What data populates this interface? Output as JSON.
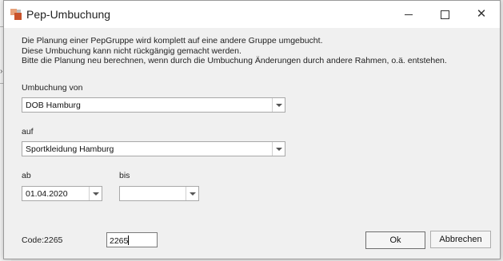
{
  "window": {
    "title": "Pep-Umbuchung",
    "close_glyph": "✕"
  },
  "info": {
    "line1": "Die Planung einer PepGruppe wird komplett auf eine andere Gruppe umgebucht.",
    "line2": "Diese Umbuchung kann nicht rückgängig gemacht werden.",
    "line3": "Bitte die Planung neu berechnen, wenn durch die Umbuchung Änderungen durch andere Rahmen, o.ä. entstehen."
  },
  "umbuchung_von": {
    "label": "Umbuchung von",
    "value": "DOB Hamburg"
  },
  "auf": {
    "label": "auf",
    "value": "Sportkleidung Hamburg"
  },
  "ab": {
    "label": "ab",
    "value": "01.04.2020"
  },
  "bis": {
    "label": "bis",
    "value": ""
  },
  "code": {
    "label": "Code:2265",
    "input_value": "2265"
  },
  "buttons": {
    "ok": "Ok",
    "cancel": "Abbrechen"
  }
}
